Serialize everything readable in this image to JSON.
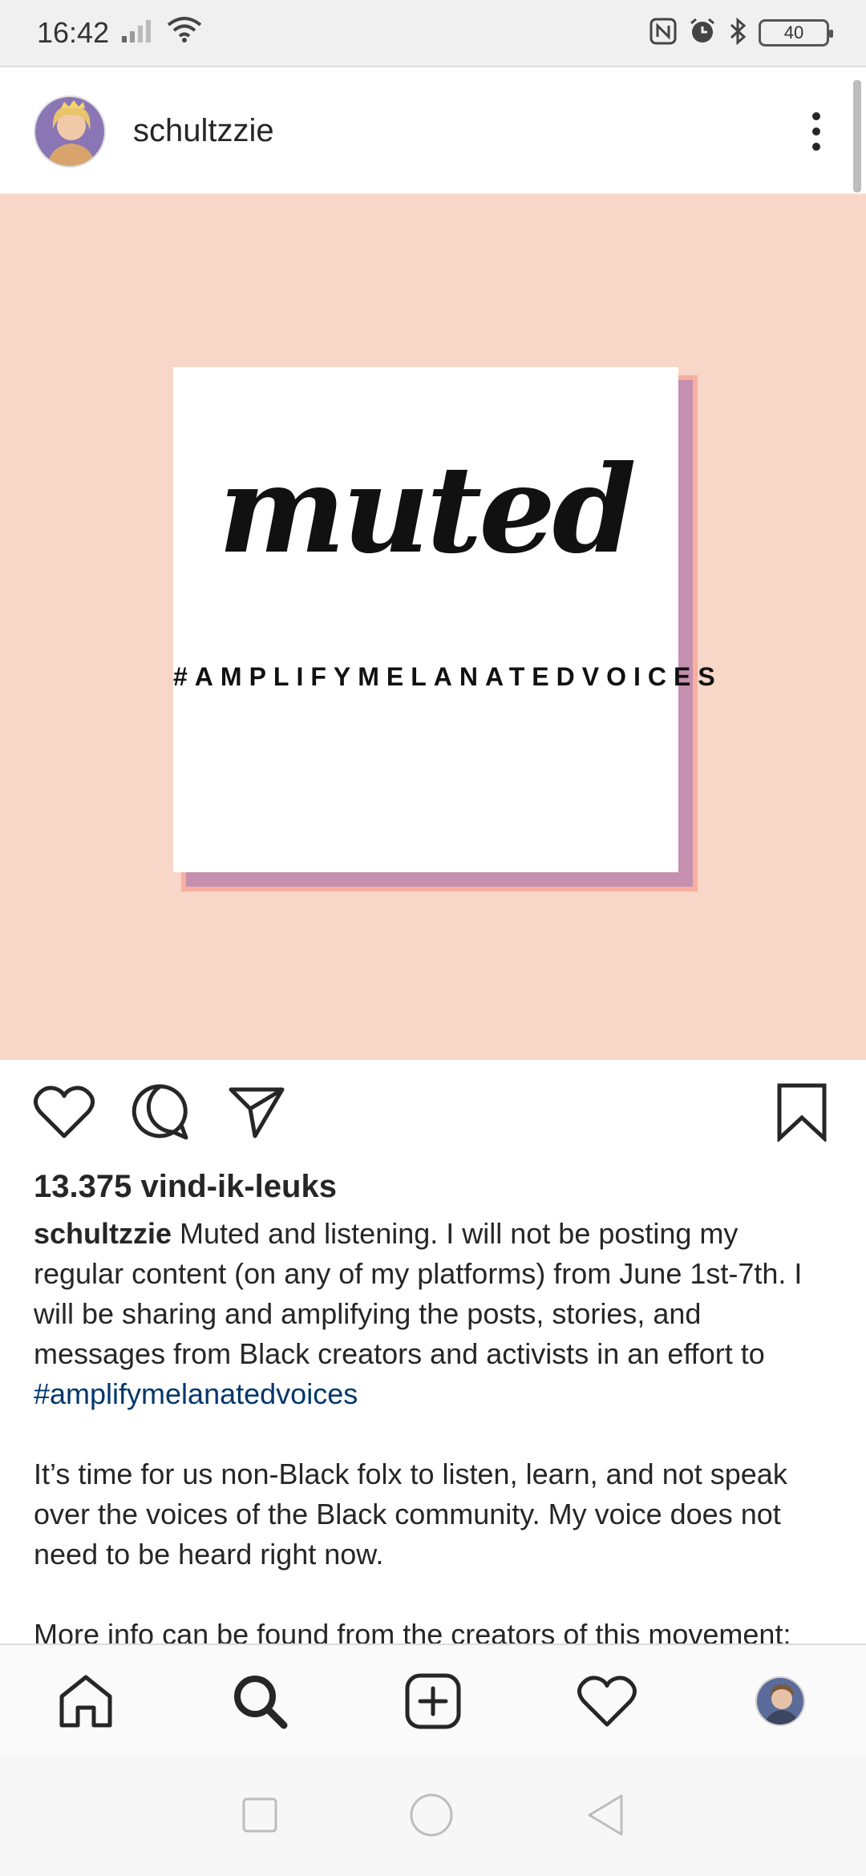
{
  "status_bar": {
    "time": "16:42",
    "battery": "40",
    "icons": [
      "signal-icon",
      "wifi-icon",
      "nfc-icon",
      "alarm-icon",
      "bluetooth-icon",
      "battery-icon"
    ]
  },
  "post": {
    "username": "schultzzie",
    "image": {
      "title": "muted",
      "hashtag": "#AMPLIFYMELANATEDVOICES",
      "background_color": "#f8d6c8",
      "shadow_color": "#c58fb0"
    },
    "likes": "13.375 vind-ik-leuks",
    "caption_user": "schultzzie",
    "caption_text": " Muted and listening. I will not be posting my regular content (on any of my platforms) from June 1st-7th. I will be sharing and amplifying the posts, stories, and messages from Black creators and activists in an effort to ",
    "caption_hashtag": "#amplifymelanatedvoices",
    "paragraph_2": "It’s time for us non-Black folx to listen, learn, and not speak over the voices of the Black community. My voice does not need to be heard right now.",
    "paragraph_3": "More info can be found from the creators of this movement:"
  },
  "bottom_nav": [
    "home-icon",
    "search-icon",
    "new-post-icon",
    "activity-heart-icon",
    "profile-avatar"
  ],
  "colors": {
    "link": "#00376b",
    "text": "#262626"
  }
}
